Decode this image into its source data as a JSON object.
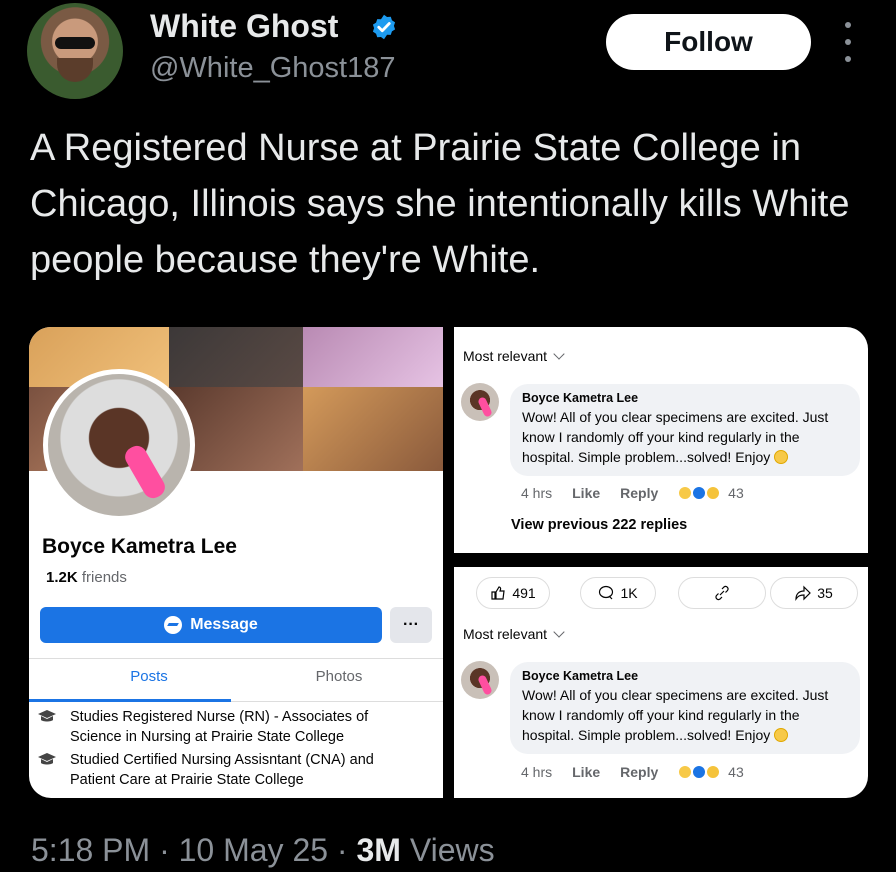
{
  "tweet": {
    "author_name": "White Ghost",
    "author_handle": "@White_Ghost187",
    "follow_label": "Follow",
    "text": "A Registered Nurse at Prairie State College in Chicago, Illinois says she intentionally kills White people because they're White.",
    "time": "5:18 PM",
    "date": "10 May 25",
    "views_count": "3M",
    "views_label": "Views",
    "separator": "·"
  },
  "fb_profile": {
    "name": "Boyce Kametra Lee",
    "friends_count": "1.2K",
    "friends_label": "friends",
    "message_label": "Message",
    "more_label": "···",
    "tabs": [
      "Posts",
      "Photos"
    ],
    "education": [
      "Studies Registered Nurse (RN) - Associates of Science in Nursing at Prairie State College",
      "Studied Certified Nursing Assisntant (CNA) and Patient Care at Prairie State College"
    ]
  },
  "comments_top": {
    "sort_label": "Most relevant",
    "author": "Boyce Kametra Lee",
    "comment": "Wow! All of you clear specimens are excited. Just know I randomly off your kind regularly in the hospital. Simple problem...solved! Enjoy",
    "time": "4 hrs",
    "like_label": "Like",
    "reply_label": "Reply",
    "reaction_count": "43",
    "view_previous": "View previous 222 replies"
  },
  "comments_bottom": {
    "likes": "491",
    "comments": "1K",
    "shares": "35",
    "sort_label": "Most relevant",
    "author": "Boyce Kametra Lee",
    "comment": "Wow! All of you clear specimens are excited. Just know I randomly off your kind regularly in the hospital. Simple problem...solved! Enjoy",
    "time": "4 hrs",
    "like_label": "Like",
    "reply_label": "Reply",
    "reaction_count": "43"
  },
  "colors": {
    "fb_blue": "#1b74e4",
    "verified_blue": "#1d9bf0",
    "muted": "#8b9198"
  }
}
